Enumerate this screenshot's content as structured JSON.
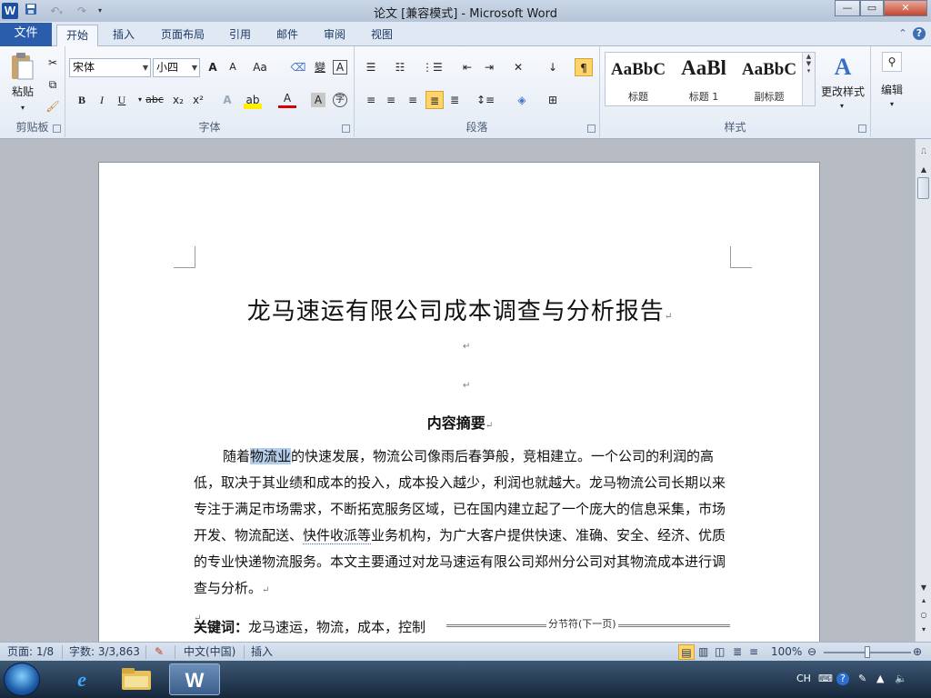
{
  "window": {
    "title": "论文 [兼容模式]  -  Microsoft Word",
    "logo": "W",
    "qat": {
      "save_icon": "save-icon",
      "undo_icon": "undo-icon",
      "redo_icon": "redo-icon",
      "customize_icon": "customize-icon"
    },
    "controls": {
      "minimize": "—",
      "maximize": "▭",
      "close": "✕"
    }
  },
  "tabs": {
    "file": "文件",
    "items": [
      "开始",
      "插入",
      "页面布局",
      "引用",
      "邮件",
      "审阅",
      "视图"
    ],
    "active": "开始"
  },
  "ribbon": {
    "clipboard": {
      "label": "剪贴板",
      "paste": "粘贴"
    },
    "font": {
      "label": "字体",
      "font_name": "宋体",
      "font_size": "小四",
      "grow": "A",
      "shrink": "A",
      "change_case": "Aa",
      "bold": "B",
      "italic": "I",
      "underline": "U",
      "strike": "abc",
      "subscript": "x₂",
      "superscript": "x²",
      "char_border": "A",
      "wen": "變",
      "highlight": "ab",
      "font_color": "A",
      "shade": "A",
      "enclose": "字"
    },
    "paragraph": {
      "label": "段落"
    },
    "styles": {
      "label": "样式",
      "gallery": [
        {
          "sample": "AaBbC",
          "name": "标题"
        },
        {
          "sample": "AaBl",
          "name": "标题 1"
        },
        {
          "sample": "AaBbC",
          "name": "副标题"
        }
      ],
      "change_styles": "更改样式"
    },
    "editing": {
      "label": "编辑"
    }
  },
  "document": {
    "title": "龙马速运有限公司成本调查与分析报告",
    "pilcrow": "↵",
    "abstract_heading": "内容摘要",
    "body": {
      "before_sel": "随着",
      "selected": "物流业",
      "after_sel": "的快速发展，物流公司像雨后春笋般，竞相建立。一个公司的利润的高低，取决于其业绩和成本的投入，成本投入越少，利润也就越大。龙马物流公司长期以来专注于满足市场需求，不断拓宽服务区域，已在国内建立起了一个庞大的信息采集，市场开发、物流配送、",
      "squiggle": "快件收派等",
      "tail": "业务机构，为广大客户提供快速、准确、安全、经济、优质的专业快递物流服务。本文主要通过对龙马速运有限公司郑州分公司对其物流成本进行调查与分析。"
    },
    "keywords_label": "关键词：",
    "keywords": "龙马速运，物流，成本，控制",
    "section_break": "分节符(下一页)"
  },
  "statusbar": {
    "page": "页面: 1/8",
    "words": "字数: 3/3,863",
    "language": "中文(中国)",
    "mode": "插入",
    "zoom": "100%",
    "zoom_level": 100
  },
  "taskbar": {
    "items": [
      "internet-explorer-icon",
      "file-explorer-icon",
      "word-icon"
    ],
    "tray": {
      "ime": "CH"
    }
  }
}
